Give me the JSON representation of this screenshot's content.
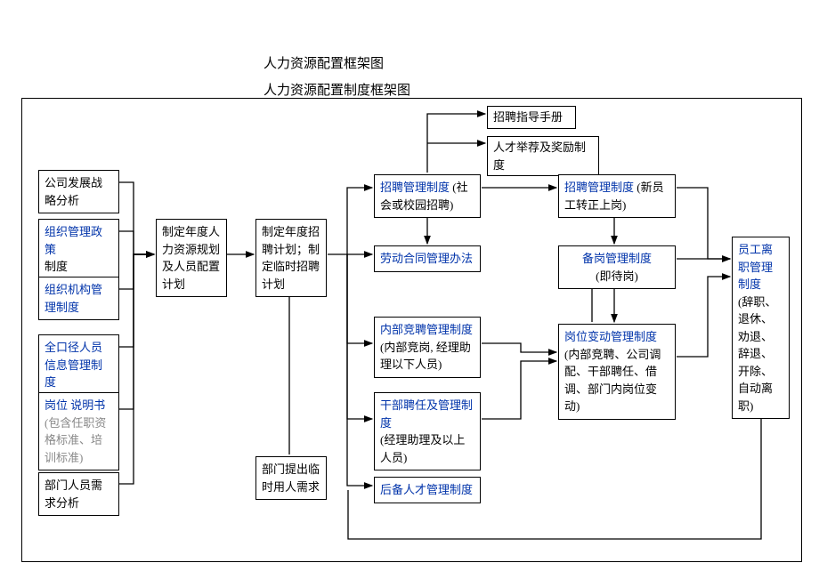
{
  "titles": {
    "t1": "人力资源配置框架图",
    "t2": "人力资源配置制度框架图"
  },
  "boxes": {
    "b1_1": "公司发展战略分析",
    "b1_2": {
      "policy": "组织管理政策",
      "suffix": "制度"
    },
    "b1_3": {
      "title": "组织机构管理制度"
    },
    "b1_4": {
      "title": "全口径人员信息管理制度"
    },
    "b1_5": {
      "title": "岗位 说明书",
      "note": "(包含任职资格标准、培训标准)"
    },
    "b1_6": "部门人员需求分析",
    "b2": "制定年度人力资源规划及人员配置计划",
    "b3": "制定年度招聘计划；制定临时招聘计划",
    "b3b": "部门提出临时用人需求",
    "topA": "招聘指导手册",
    "topB": "人才举荐及奖励制度",
    "c1": {
      "title": "招聘管理制度",
      "note": "(社会或校园招聘)"
    },
    "c2": {
      "title": "劳动合同管理办法"
    },
    "c3": {
      "title": "内部竞聘管理制度",
      "note": "(内部竞岗, 经理助理以下人员)"
    },
    "c4": {
      "title": "干部聘任及管理制度",
      "note": "(经理助理及以上人员)"
    },
    "c5": {
      "title": "后备人才管理制度"
    },
    "d1": {
      "title": "招聘管理制度",
      "note": "(新员工转正上岗)"
    },
    "d2": {
      "title": "备岗管理制度",
      "note": "(即待岗)"
    },
    "d3": {
      "title": "岗位变动管理制度",
      "note": "(内部竞聘、公司调配、干部聘任、借调、部门内岗位变动)"
    },
    "e1": {
      "title": "员工离职管理制度",
      "note": "(辞职、退休、劝退、辞退、 开除、自动离职)"
    }
  }
}
